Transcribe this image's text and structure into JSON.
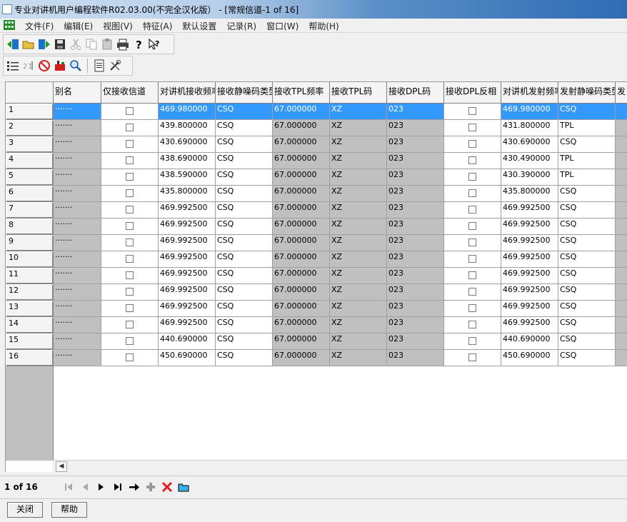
{
  "window": {
    "title": "专业对讲机用户编程软件R02.03.00(不完全汉化版） - [常规信道-1 of 16]"
  },
  "menu": [
    "文件(F)",
    "编辑(E)",
    "视图(V)",
    "特征(A)",
    "默认设置",
    "记录(R)",
    "窗口(W)",
    "帮助(H)"
  ],
  "toolbar1_icons": [
    "read-radio-icon",
    "open-folder-icon",
    "write-radio-icon",
    "save-icon",
    "cut-icon",
    "copy-icon",
    "paste-icon",
    "print-icon",
    "help-icon",
    "context-help-icon"
  ],
  "toolbar2_icons": [
    "channel-list-icon",
    "sort-icon",
    "no-entry-icon",
    "delete-row-icon",
    "find-icon",
    "document-icon",
    "tools-icon"
  ],
  "grid": {
    "columns": [
      "别名",
      "仅接收信道",
      "对讲机接收频率",
      "接收静噪码类型",
      "接收TPL频率",
      "接收TPL码",
      "接收DPL码",
      "接收DPL反相",
      "对讲机发射频率",
      "发射静噪码类型",
      "发"
    ],
    "rows": [
      {
        "n": "1",
        "alias": "·······",
        "rx": "469.980000",
        "rxsq": "CSQ",
        "tpl": "67.000000",
        "tplc": "XZ",
        "dpl": "023",
        "tx": "469.980000",
        "txsq": "CSQ"
      },
      {
        "n": "2",
        "alias": "·······",
        "rx": "439.800000",
        "rxsq": "CSQ",
        "tpl": "67.000000",
        "tplc": "XZ",
        "dpl": "023",
        "tx": "431.800000",
        "txsq": "TPL"
      },
      {
        "n": "3",
        "alias": "·······",
        "rx": "430.690000",
        "rxsq": "CSQ",
        "tpl": "67.000000",
        "tplc": "XZ",
        "dpl": "023",
        "tx": "430.690000",
        "txsq": "CSQ"
      },
      {
        "n": "4",
        "alias": "·······",
        "rx": "438.690000",
        "rxsq": "CSQ",
        "tpl": "67.000000",
        "tplc": "XZ",
        "dpl": "023",
        "tx": "430.490000",
        "txsq": "TPL"
      },
      {
        "n": "5",
        "alias": "·······",
        "rx": "438.590000",
        "rxsq": "CSQ",
        "tpl": "67.000000",
        "tplc": "XZ",
        "dpl": "023",
        "tx": "430.390000",
        "txsq": "TPL"
      },
      {
        "n": "6",
        "alias": "·······",
        "rx": "435.800000",
        "rxsq": "CSQ",
        "tpl": "67.000000",
        "tplc": "XZ",
        "dpl": "023",
        "tx": "435.800000",
        "txsq": "CSQ"
      },
      {
        "n": "7",
        "alias": "·······",
        "rx": "469.992500",
        "rxsq": "CSQ",
        "tpl": "67.000000",
        "tplc": "XZ",
        "dpl": "023",
        "tx": "469.992500",
        "txsq": "CSQ"
      },
      {
        "n": "8",
        "alias": "·······",
        "rx": "469.992500",
        "rxsq": "CSQ",
        "tpl": "67.000000",
        "tplc": "XZ",
        "dpl": "023",
        "tx": "469.992500",
        "txsq": "CSQ"
      },
      {
        "n": "9",
        "alias": "·······",
        "rx": "469.992500",
        "rxsq": "CSQ",
        "tpl": "67.000000",
        "tplc": "XZ",
        "dpl": "023",
        "tx": "469.992500",
        "txsq": "CSQ"
      },
      {
        "n": "10",
        "alias": "·······",
        "rx": "469.992500",
        "rxsq": "CSQ",
        "tpl": "67.000000",
        "tplc": "XZ",
        "dpl": "023",
        "tx": "469.992500",
        "txsq": "CSQ"
      },
      {
        "n": "11",
        "alias": "·······",
        "rx": "469.992500",
        "rxsq": "CSQ",
        "tpl": "67.000000",
        "tplc": "XZ",
        "dpl": "023",
        "tx": "469.992500",
        "txsq": "CSQ"
      },
      {
        "n": "12",
        "alias": "·······",
        "rx": "469.992500",
        "rxsq": "CSQ",
        "tpl": "67.000000",
        "tplc": "XZ",
        "dpl": "023",
        "tx": "469.992500",
        "txsq": "CSQ"
      },
      {
        "n": "13",
        "alias": "·······",
        "rx": "469.992500",
        "rxsq": "CSQ",
        "tpl": "67.000000",
        "tplc": "XZ",
        "dpl": "023",
        "tx": "469.992500",
        "txsq": "CSQ"
      },
      {
        "n": "14",
        "alias": "·······",
        "rx": "469.992500",
        "rxsq": "CSQ",
        "tpl": "67.000000",
        "tplc": "XZ",
        "dpl": "023",
        "tx": "469.992500",
        "txsq": "CSQ"
      },
      {
        "n": "15",
        "alias": "·······",
        "rx": "440.690000",
        "rxsq": "CSQ",
        "tpl": "67.000000",
        "tplc": "XZ",
        "dpl": "023",
        "tx": "440.690000",
        "txsq": "CSQ"
      },
      {
        "n": "16",
        "alias": "·······",
        "rx": "450.690000",
        "rxsq": "CSQ",
        "tpl": "67.000000",
        "tplc": "XZ",
        "dpl": "023",
        "tx": "450.690000",
        "txsq": "CSQ"
      }
    ],
    "selected_row": "1"
  },
  "nav": {
    "page_count": "1 of 16"
  },
  "nav_icons": [
    "first-record-icon",
    "prev-record-icon",
    "next-record-icon",
    "last-record-icon",
    "goto-record-icon",
    "add-record-icon",
    "delete-record-icon",
    "folder-record-icon"
  ],
  "buttons": {
    "close": "关闭",
    "help": "帮助"
  },
  "colors": {
    "selection": "#3399ff",
    "readonly_cell": "#c0c0c0",
    "delete": "#e02020"
  }
}
